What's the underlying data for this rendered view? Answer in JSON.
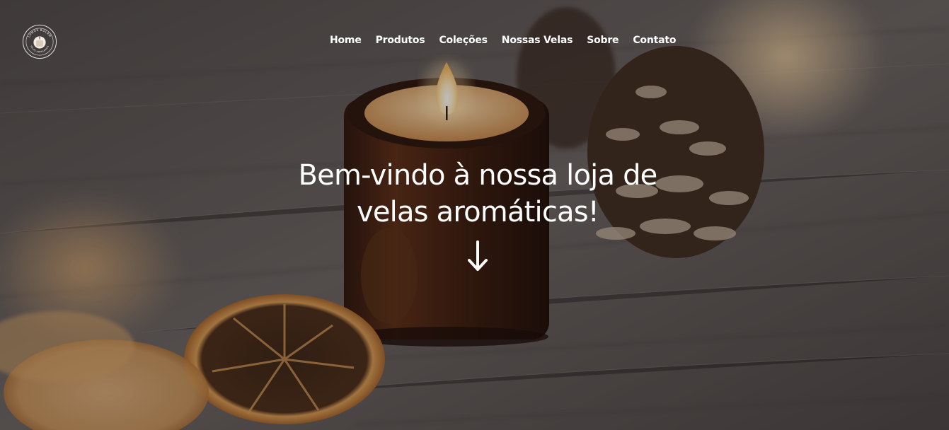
{
  "brand": {
    "logo_text_top": "LUMUS BOLAM",
    "logo_text_bottom": "VELAS ARTESANAIS"
  },
  "nav": {
    "items": [
      {
        "label": "Home"
      },
      {
        "label": "Produtos"
      },
      {
        "label": "Coleções"
      },
      {
        "label": "Nossas Velas"
      },
      {
        "label": "Sobre"
      },
      {
        "label": "Contato"
      }
    ]
  },
  "hero": {
    "headline": "Bem-vindo à nossa loja de velas aromáticas!",
    "scroll_icon": "arrow-down-icon"
  },
  "colors": {
    "text": "#ffffff",
    "wood": "#5a5250",
    "amber": "#6b3a1f",
    "flame": "#ffe8b0",
    "orange_slice": "#c8843c"
  }
}
